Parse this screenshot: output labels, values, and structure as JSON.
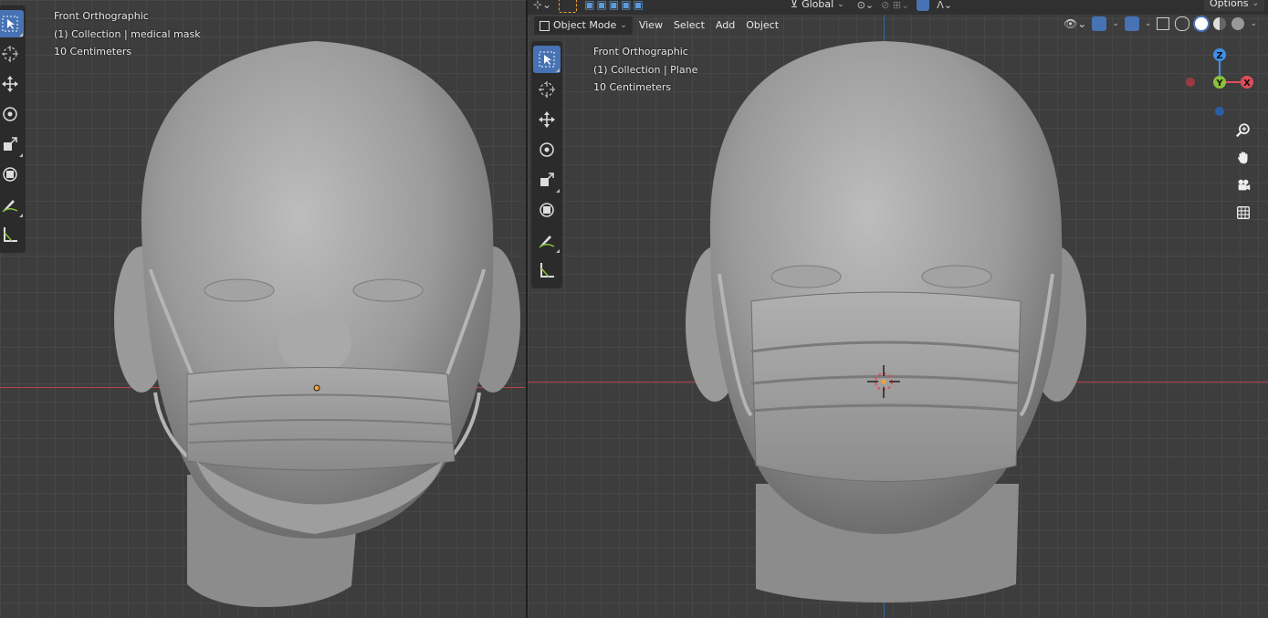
{
  "left_view": {
    "view_name": "Front Orthographic",
    "collection": "(1) Collection | medical mask",
    "scale": "10 Centimeters"
  },
  "right_view": {
    "view_name": "Front Orthographic",
    "collection": "(1) Collection | Plane",
    "scale": "10 Centimeters"
  },
  "header": {
    "mode": "Object Mode",
    "menus": [
      "View",
      "Select",
      "Add",
      "Object"
    ],
    "transform_orientation": "Global",
    "options": "Options"
  },
  "gizmo": {
    "z": "Z",
    "y": "Y",
    "x": "X"
  },
  "colors": {
    "x_axis": "#b3454b",
    "z_axis": "#3565a5",
    "active_tool": "#4772b3",
    "gizmo_x": "#e24d5b",
    "gizmo_y": "#8ac23b",
    "gizmo_z": "#3f8fe8"
  },
  "tools": [
    "select-box-icon",
    "cursor-icon",
    "move-icon",
    "rotate-icon",
    "scale-icon",
    "transform-icon",
    "annotate-icon",
    "measure-icon"
  ]
}
